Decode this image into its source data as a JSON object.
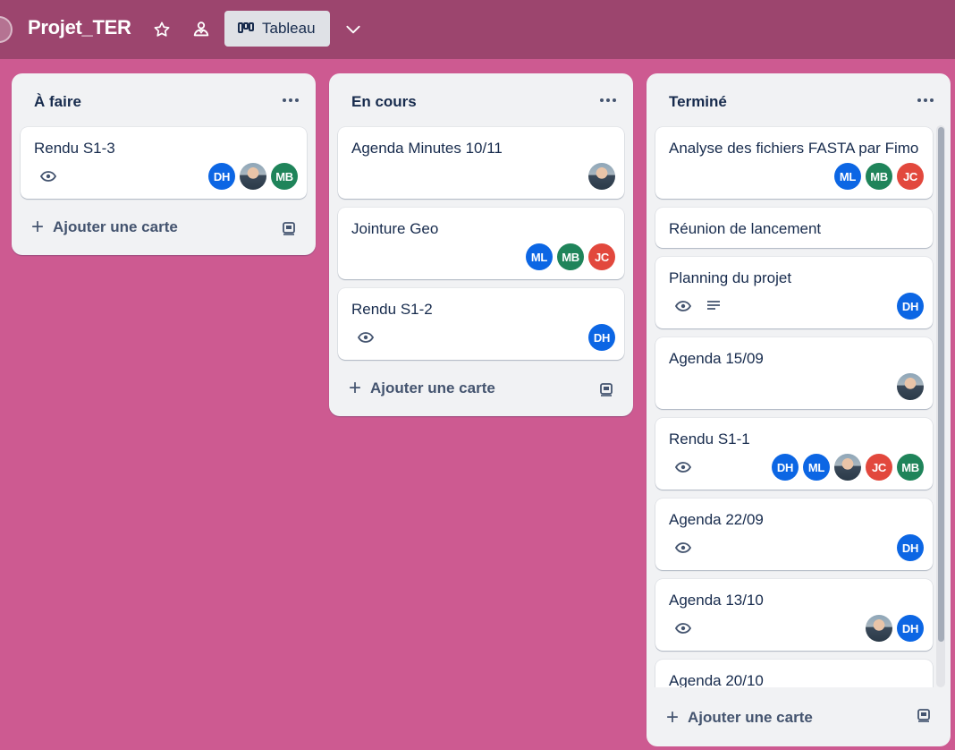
{
  "board": {
    "title": "Projet_TER",
    "view_label": "Tableau"
  },
  "colors": {
    "background": "#cd5a91",
    "header": "#9c456e",
    "avatar_DH": "#0c66e4",
    "avatar_ML": "#0c66e4",
    "avatar_MB": "#1f845a",
    "avatar_JC": "#e2483d"
  },
  "lists": [
    {
      "title": "À faire",
      "add_label": "Ajouter une carte",
      "cards": [
        {
          "title": "Rendu S1-3",
          "members": [
            "DH",
            "photo",
            "MB"
          ]
        }
      ]
    },
    {
      "title": "En cours",
      "add_label": "Ajouter une carte",
      "cards": [
        {
          "title": "Agenda Minutes 10/11",
          "members": [
            "photo"
          ]
        },
        {
          "title": "Jointure Geo",
          "members": [
            "ML",
            "MB",
            "JC"
          ]
        },
        {
          "title": "Rendu S1-2",
          "members": [
            "DH"
          ]
        }
      ]
    },
    {
      "title": "Terminé",
      "add_label": "Ajouter une carte",
      "cards": [
        {
          "title": "Analyse des fichiers FASTA par Fimo",
          "members": [
            "ML",
            "MB",
            "JC"
          ]
        },
        {
          "title": "Réunion de lancement",
          "members": []
        },
        {
          "title": "Planning du projet",
          "members": [
            "DH"
          ]
        },
        {
          "title": "Agenda 15/09",
          "members": [
            "photo"
          ]
        },
        {
          "title": "Rendu S1-1",
          "members": [
            "DH",
            "ML",
            "photo",
            "JC",
            "MB"
          ]
        },
        {
          "title": "Agenda 22/09",
          "members": [
            "DH"
          ]
        },
        {
          "title": "Agenda 13/10",
          "members": [
            "photo",
            "DH"
          ]
        },
        {
          "title": "Agenda 20/10",
          "members": []
        }
      ]
    }
  ],
  "icons": {
    "star": "star-icon",
    "members": "members-icon",
    "board_view": "board-view-icon",
    "chevron": "chevron-down-icon",
    "watch": "eye-icon",
    "description": "description-icon",
    "template": "card-template-icon"
  }
}
